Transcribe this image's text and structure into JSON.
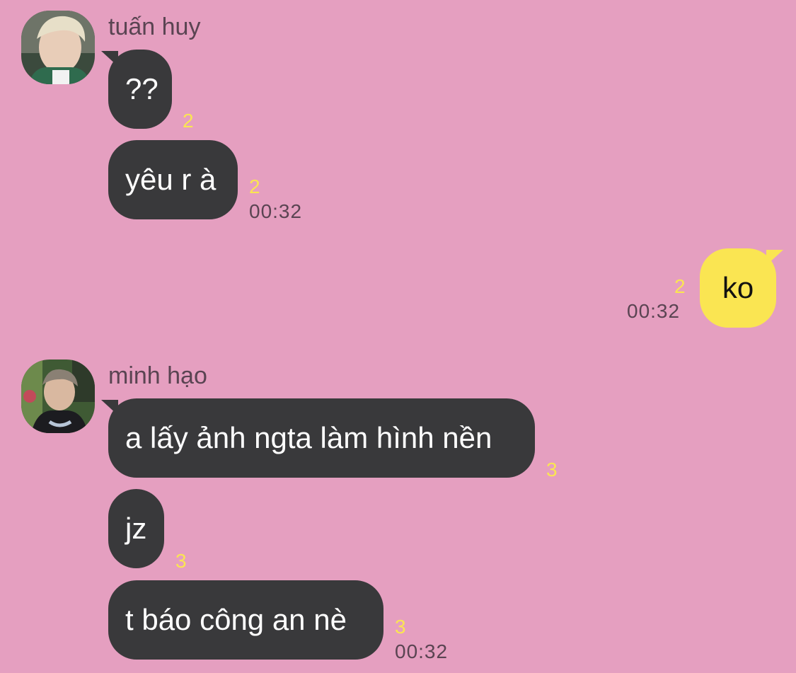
{
  "theme": {
    "background": "#e59fc0",
    "incoming_bubble": "#39393b",
    "outgoing_bubble": "#fae552",
    "unread_count": "#fae552",
    "meta_text": "#5a4452"
  },
  "groups": [
    {
      "sender": "tuấn huy",
      "messages": [
        {
          "text": "??",
          "unread": "2"
        },
        {
          "text": "yêu r à",
          "unread": "2",
          "time": "00:32"
        }
      ]
    },
    {
      "sender": "me",
      "messages": [
        {
          "text": "ko",
          "unread": "2",
          "time": "00:32"
        }
      ]
    },
    {
      "sender": "minh hạo",
      "messages": [
        {
          "text": "a lấy ảnh ngta làm hình nền",
          "unread": "3"
        },
        {
          "text": "jz",
          "unread": "3"
        },
        {
          "text": "t báo công an nè",
          "unread": "3",
          "time": "00:32"
        }
      ]
    }
  ]
}
